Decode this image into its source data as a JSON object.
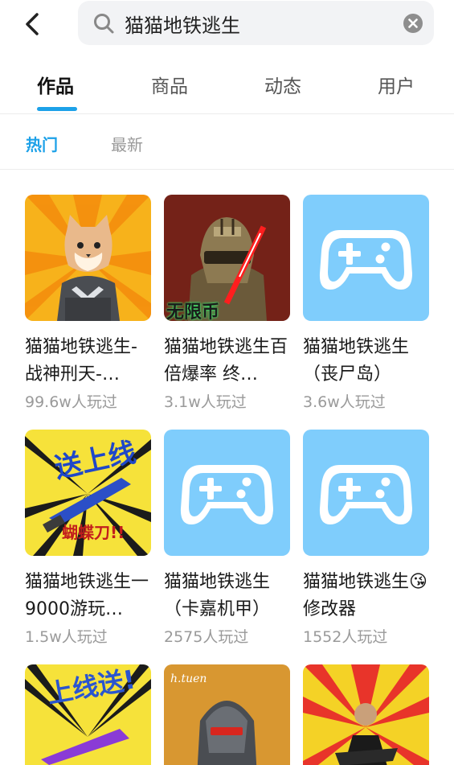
{
  "search": {
    "query": "猫猫地铁逃生"
  },
  "tabs": [
    {
      "label": "作品",
      "active": true
    },
    {
      "label": "商品",
      "active": false
    },
    {
      "label": "动态",
      "active": false
    },
    {
      "label": "用户",
      "active": false
    }
  ],
  "subtabs": [
    {
      "label": "热门",
      "active": true
    },
    {
      "label": "最新",
      "active": false
    }
  ],
  "accent_color": "#1da1e8",
  "items": [
    {
      "title": "猫猫地铁逃生-战神刑天-…",
      "plays": "99.6w人玩过",
      "thumb": "cat-soldier-art"
    },
    {
      "title": "猫猫地铁逃生百倍爆率 终…",
      "plays": "3.1w人玩过",
      "thumb": "armored-soldier-art",
      "thumb_text": "无限币"
    },
    {
      "title": "猫猫地铁逃生（丧尸岛）",
      "plays": "3.6w人玩过",
      "thumb": "gamepad-icon"
    },
    {
      "title": "猫猫地铁逃生一9000游玩…",
      "plays": "1.5w人玩过",
      "thumb": "knife-art"
    },
    {
      "title": "猫猫地铁逃生（卡嘉机甲）",
      "plays": "2575人玩过",
      "thumb": "gamepad-icon"
    },
    {
      "title": "猫猫地铁逃生😘修改器",
      "plays": "1552人玩过",
      "thumb": "gamepad-icon"
    },
    {
      "title": "",
      "plays": "",
      "thumb": "knife-art-purple"
    },
    {
      "title": "",
      "plays": "",
      "thumb": "robot-soldier-art"
    },
    {
      "title": "",
      "plays": "",
      "thumb": "explosion-art"
    }
  ]
}
